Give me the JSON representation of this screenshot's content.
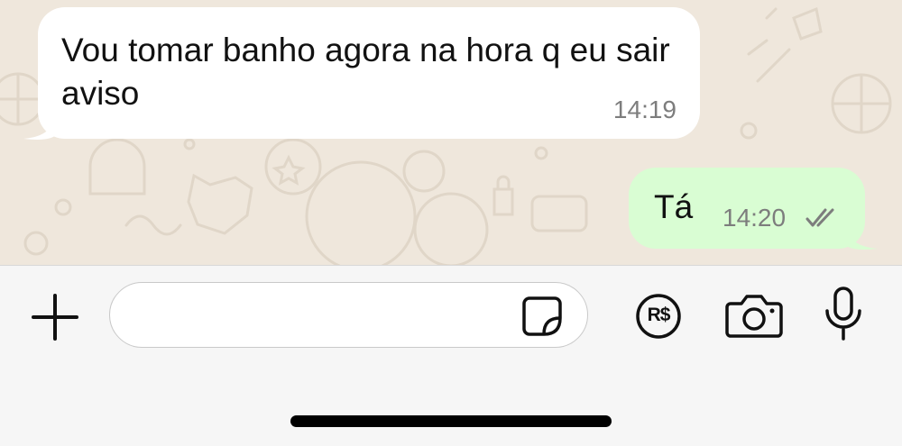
{
  "messages": [
    {
      "direction": "incoming",
      "text": "Vou tomar banho agora na hora q eu sair aviso",
      "time": "14:19"
    },
    {
      "direction": "outgoing",
      "text": "Tá",
      "time": "14:20",
      "status": "read"
    }
  ],
  "composer": {
    "value": "",
    "placeholder": "",
    "icons": [
      "plus-icon",
      "sticker-icon",
      "pix-icon",
      "camera-icon",
      "microphone-icon"
    ],
    "pix_label": "R$"
  },
  "colors": {
    "chat_bg": "#efe7dc",
    "incoming_bubble": "#ffffff",
    "outgoing_bubble": "#d9fdd3",
    "timestamp": "#7d7d7d"
  }
}
